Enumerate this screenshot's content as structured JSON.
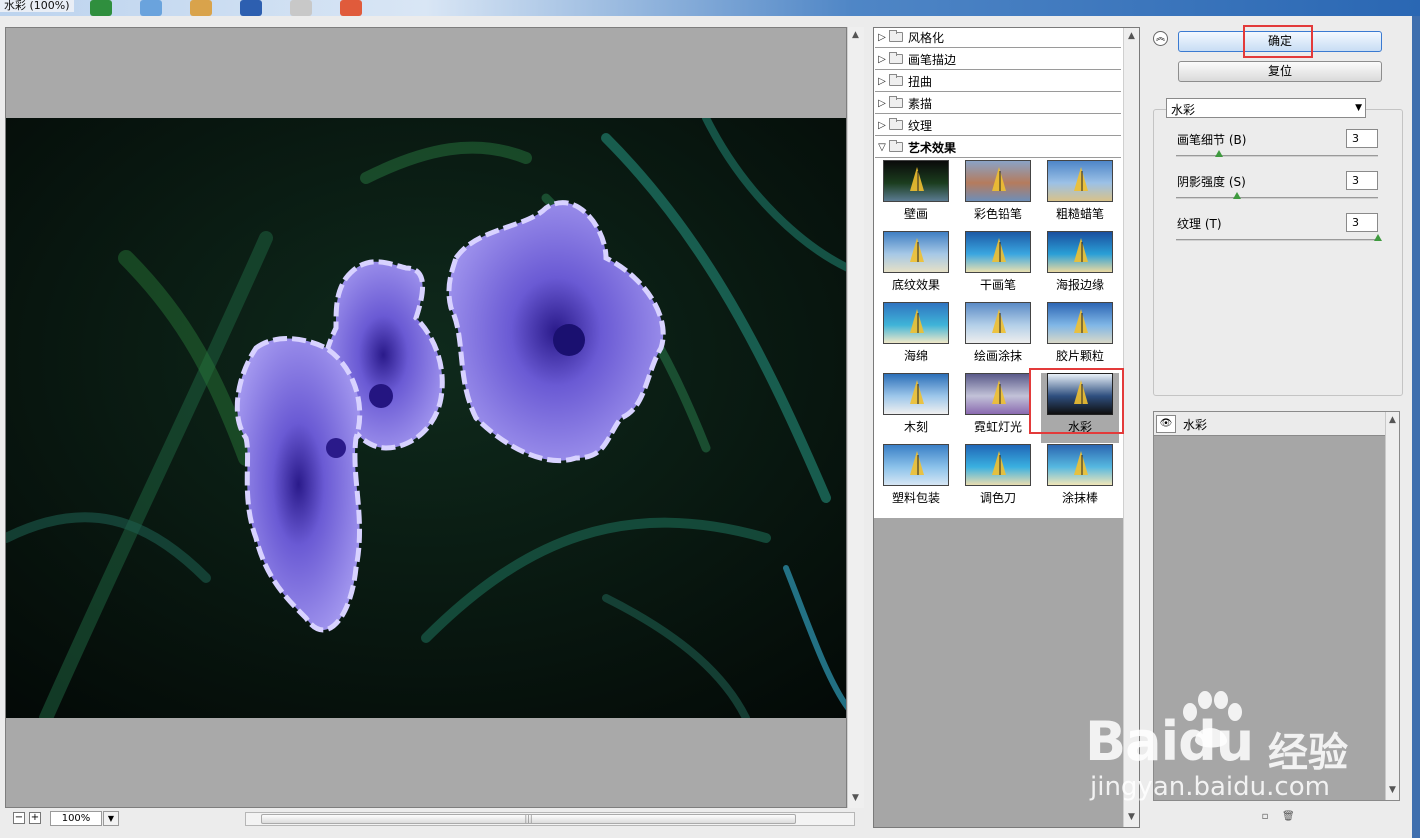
{
  "window": {
    "title": "水彩 (100%)"
  },
  "preview": {
    "zoom": "100%"
  },
  "gallery": {
    "folders": [
      {
        "label": "风格化",
        "open": false
      },
      {
        "label": "画笔描边",
        "open": false
      },
      {
        "label": "扭曲",
        "open": false
      },
      {
        "label": "素描",
        "open": false
      },
      {
        "label": "纹理",
        "open": false
      },
      {
        "label": "艺术效果",
        "open": true
      }
    ],
    "filters": [
      {
        "label": "壁画",
        "selected": false
      },
      {
        "label": "彩色铅笔",
        "selected": false
      },
      {
        "label": "粗糙蜡笔",
        "selected": false
      },
      {
        "label": "底纹效果",
        "selected": false
      },
      {
        "label": "干画笔",
        "selected": false
      },
      {
        "label": "海报边缘",
        "selected": false
      },
      {
        "label": "海绵",
        "selected": false
      },
      {
        "label": "绘画涂抹",
        "selected": false
      },
      {
        "label": "胶片颗粒",
        "selected": false
      },
      {
        "label": "木刻",
        "selected": false
      },
      {
        "label": "霓虹灯光",
        "selected": false
      },
      {
        "label": "水彩",
        "selected": true
      },
      {
        "label": "塑料包装",
        "selected": false
      },
      {
        "label": "调色刀",
        "selected": false
      },
      {
        "label": "涂抹棒",
        "selected": false
      }
    ]
  },
  "settings": {
    "ok_label": "确定",
    "reset_label": "复位",
    "filter_select": "水彩",
    "params": [
      {
        "label": "画笔细节 (B)",
        "value": "3",
        "max": 14
      },
      {
        "label": "阴影强度 (S)",
        "value": "3",
        "max": 10
      },
      {
        "label": "纹理 (T)",
        "value": "3",
        "max": 3
      }
    ]
  },
  "layers": {
    "items": [
      {
        "name": "水彩"
      }
    ]
  },
  "watermark": {
    "brand": "Baidu",
    "cn": "经验",
    "url": "jingyan.baidu.com"
  },
  "colors": {
    "accent_red": "#e33a3a",
    "knob_green": "#3f9a3f"
  }
}
